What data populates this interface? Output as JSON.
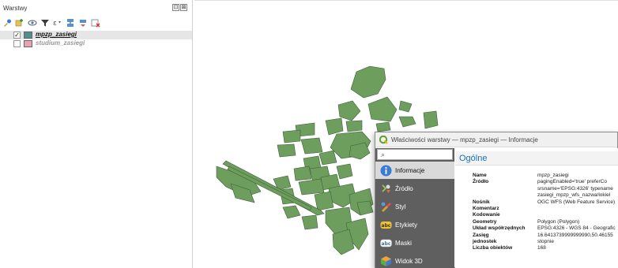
{
  "layers_panel": {
    "title": "Warstwy",
    "controls": [
      "⊡",
      "⊠"
    ],
    "toolbar_icons": [
      "open-layer-styling-icon",
      "add-group-icon",
      "manage-map-themes-icon",
      "filter-legend-icon",
      "filter-by-expression-icon",
      "expand-all-icon",
      "collapse-all-icon",
      "remove-layer-icon"
    ],
    "layers": [
      {
        "name": "mpzp_zasiegi",
        "checked": true,
        "check_mark": "✓",
        "color": "#4f8f8f"
      },
      {
        "name": "studium_zasiegi",
        "checked": false,
        "check_mark": "",
        "color": "#e8a3b0"
      }
    ]
  },
  "map": {
    "polygon_color": "#6e9e5e",
    "polygon_stroke": "#3f5f3a"
  },
  "dialog": {
    "title": "Właściwości warstwy — mpzp_zasiegi — Informacje",
    "search_icon": "⌕",
    "nav": [
      {
        "label": "Informacje",
        "icon": "info-icon"
      },
      {
        "label": "Źródło",
        "icon": "source-icon"
      },
      {
        "label": "Styl",
        "icon": "style-icon"
      },
      {
        "label": "Etykiety",
        "icon": "labels-icon",
        "badge": "abc"
      },
      {
        "label": "Maski",
        "icon": "masks-icon",
        "badge": "abc"
      },
      {
        "label": "Widok 3D",
        "icon": "3d-view-icon"
      }
    ],
    "section_title": "Ogólne",
    "rows": [
      {
        "key": "Name",
        "value": "mpzp_zasiegi"
      },
      {
        "key": "Źródło",
        "value": "pagingEnabled='true' preferCo"
      },
      {
        "key": "",
        "value": "srsname='EPSG:4326' typename"
      },
      {
        "key": "",
        "value": "zasiegi_mpzp_wfs_nazwa/lokiel"
      },
      {
        "key": "Nośnik",
        "value": "OGC WFS (Web Feature Service)"
      },
      {
        "key": "Komentarz",
        "value": ""
      },
      {
        "key": "Kodowanie",
        "value": ""
      },
      {
        "key": "Geometry",
        "value": "Polygon (Polygon)"
      },
      {
        "key": "Układ współrzędnych",
        "value": "EPSG:4326 - WGS 84 - Geografic"
      },
      {
        "key": "Zasięg",
        "value": "16.6413739999999990,50.46155"
      },
      {
        "key": "jednostek",
        "value": "stopnie"
      },
      {
        "key": "Liczba obiektów",
        "value": "168"
      }
    ]
  }
}
